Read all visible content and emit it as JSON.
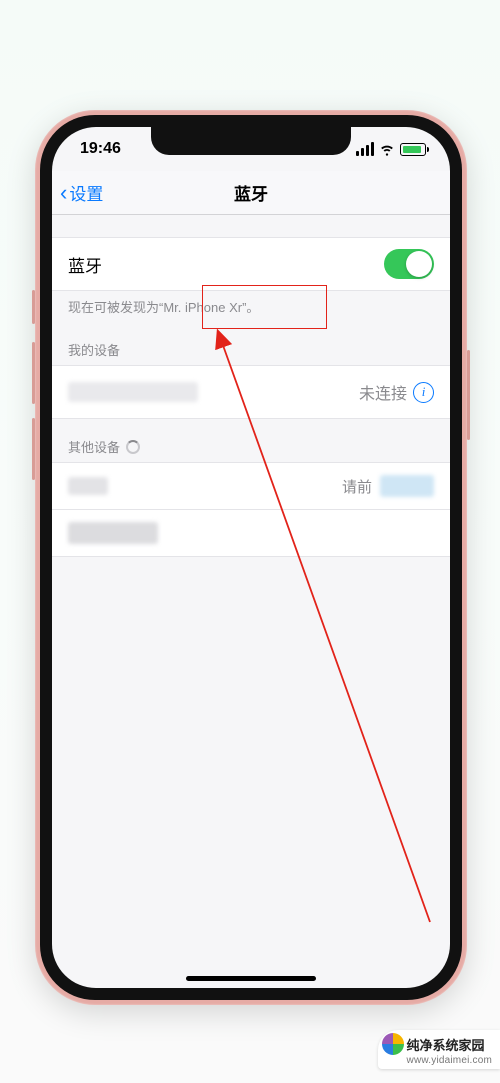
{
  "status_bar": {
    "time": "19:46"
  },
  "navbar": {
    "back_label": "设置",
    "title": "蓝牙"
  },
  "bluetooth": {
    "label": "蓝牙",
    "enabled": true,
    "discoverable_note": "现在可被发现为“Mr. iPhone Xr”。"
  },
  "sections": {
    "my_devices_header": "我的设备",
    "other_devices_header": "其他设备"
  },
  "my_devices": [
    {
      "status_text": "未连接"
    }
  ],
  "other_devices_hint": "请前",
  "watermark": {
    "name": "纯净系统家园",
    "url": "www.yidaimei.com"
  }
}
